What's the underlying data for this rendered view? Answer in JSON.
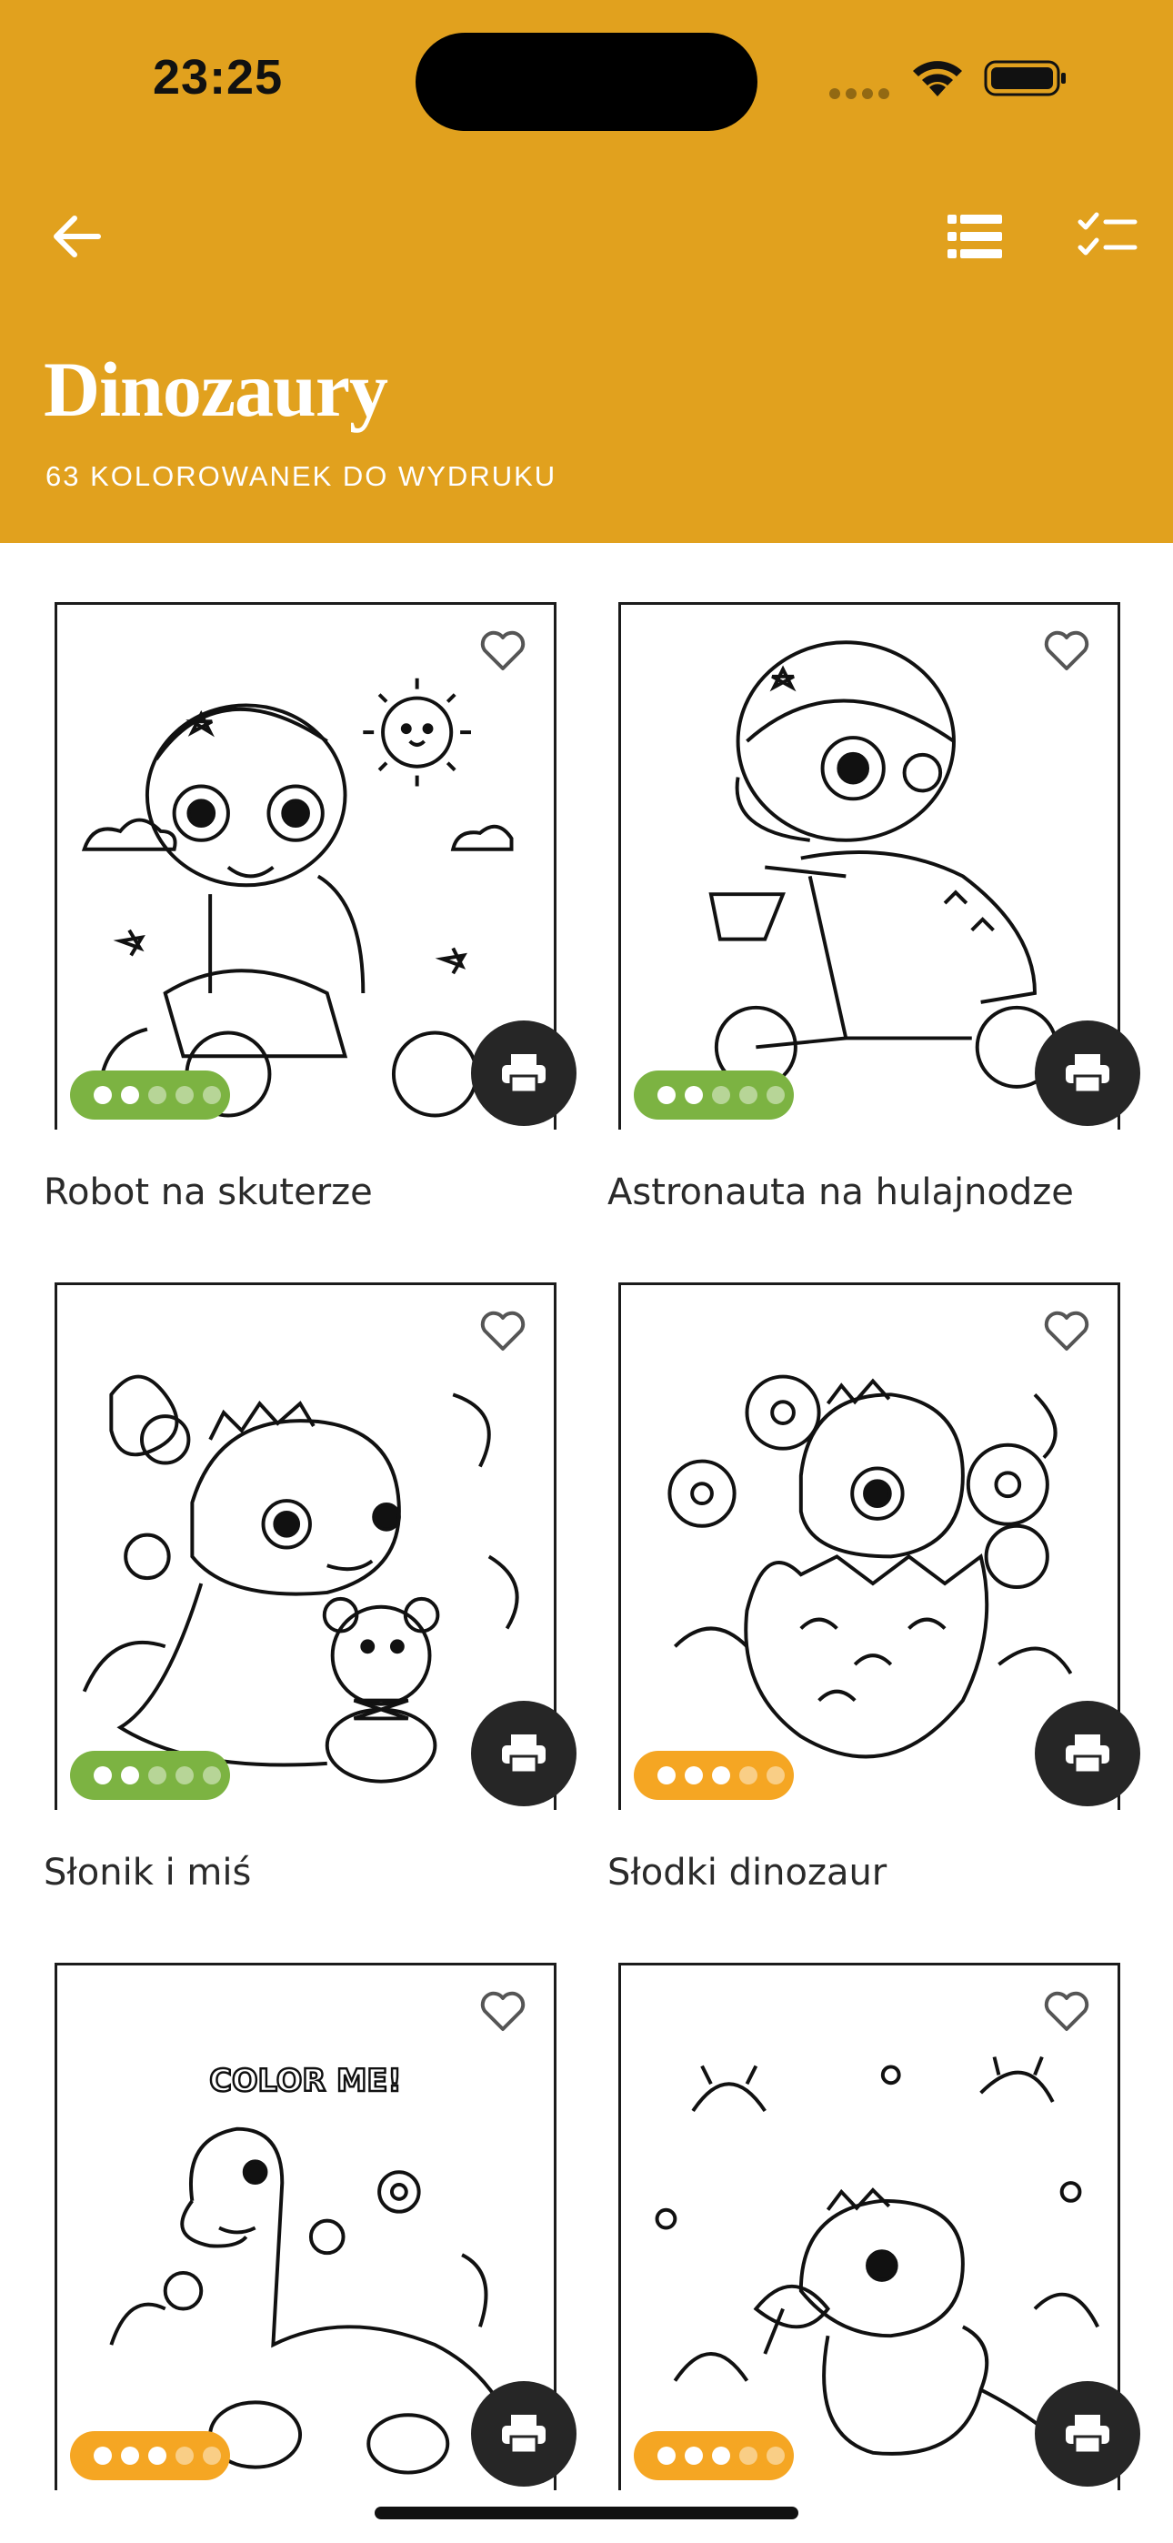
{
  "status_bar": {
    "time": "23:25"
  },
  "header": {
    "title": "Dinozaury",
    "subtitle": "63 KOLOROWANEK DO WYDRUKU",
    "background_color": "#E1A11E",
    "back_icon": "arrow-left-icon",
    "list_icon": "list-view-icon",
    "checklist_icon": "checklist-icon"
  },
  "colors": {
    "difficulty_easy": "#7CB342",
    "difficulty_medium": "#F5A623",
    "print_button": "#262626"
  },
  "cards": [
    {
      "title": "Robot na skuterze",
      "difficulty": 2,
      "difficulty_max": 5,
      "difficulty_color": "#7CB342",
      "favorite": false
    },
    {
      "title": "Astronauta na hulajnodze",
      "difficulty": 2,
      "difficulty_max": 5,
      "difficulty_color": "#7CB342",
      "favorite": false
    },
    {
      "title": "Słonik i miś",
      "difficulty": 2,
      "difficulty_max": 5,
      "difficulty_color": "#7CB342",
      "favorite": false
    },
    {
      "title": "Słodki dinozaur",
      "difficulty": 3,
      "difficulty_max": 5,
      "difficulty_color": "#F5A623",
      "favorite": false
    },
    {
      "title": "",
      "difficulty": 3,
      "difficulty_max": 5,
      "difficulty_color": "#F5A623",
      "favorite": false,
      "image_text": "COLOR ME!"
    },
    {
      "title": "",
      "difficulty": 3,
      "difficulty_max": 5,
      "difficulty_color": "#F5A623",
      "favorite": false
    }
  ]
}
